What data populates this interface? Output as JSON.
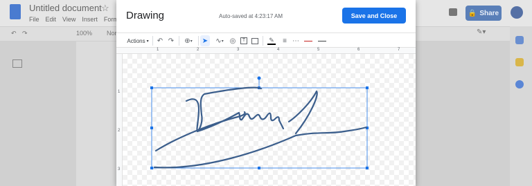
{
  "docs": {
    "title": "Untitled document",
    "menu": [
      "File",
      "Edit",
      "View",
      "Insert",
      "Format"
    ],
    "zoom": "100%",
    "style_select": "Normal",
    "share_label": "Share"
  },
  "drawing": {
    "title": "Drawing",
    "autosave": "Auto-saved at 4:23:17 AM",
    "save_close": "Save and Close",
    "actions_label": "Actions",
    "ruler_marks": [
      "1",
      "2",
      "3",
      "4",
      "5",
      "6",
      "7"
    ],
    "vruler_marks": [
      "1",
      "2",
      "3"
    ]
  },
  "colors": {
    "primary": "#1a73e8",
    "signature_stroke": "#3b5e8c",
    "selection": "#1a73e8"
  }
}
